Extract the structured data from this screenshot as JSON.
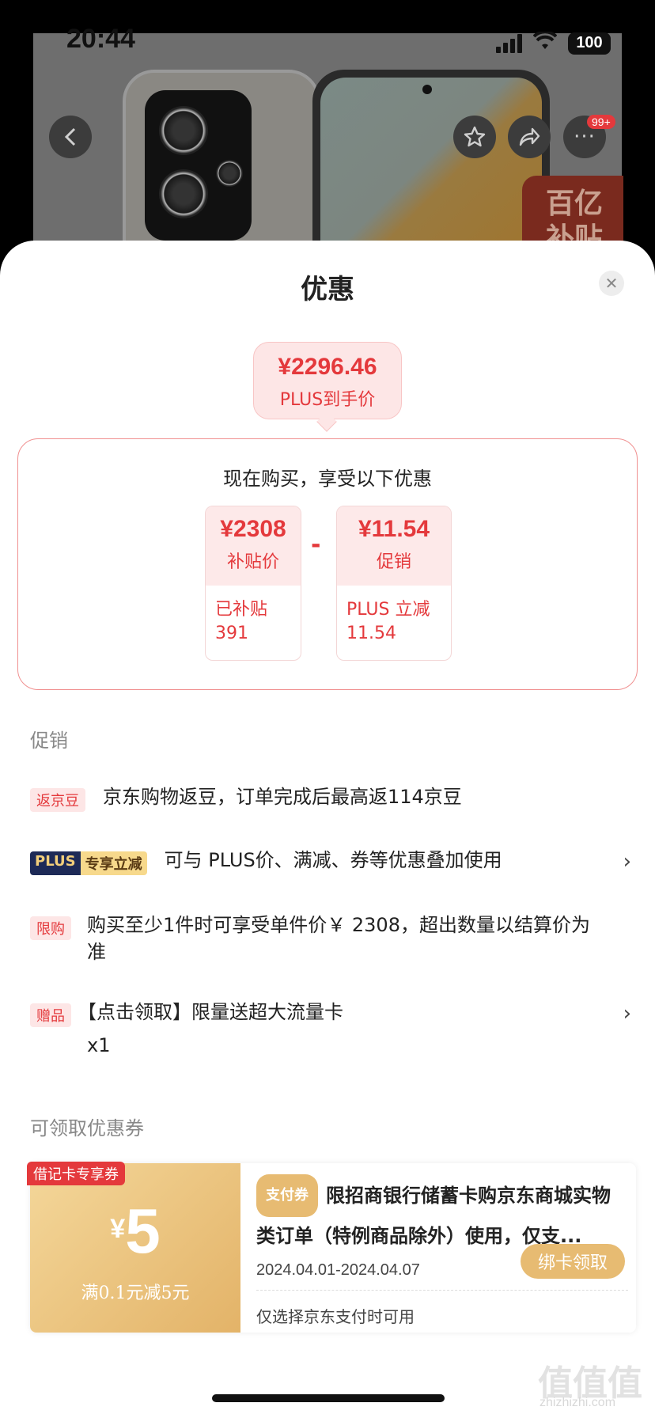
{
  "status_bar": {
    "time": "20:44",
    "battery": "100"
  },
  "top": {
    "subsidy_tag": "百亿\n补贴",
    "badge": "99+"
  },
  "sheet": {
    "title": "优惠",
    "final_price": {
      "amount": "¥2296.46",
      "label": "PLUS到手价"
    },
    "breakdown": {
      "title": "现在购买，享受以下优惠",
      "cards": [
        {
          "value": "¥2308",
          "label": "补贴价",
          "detail_line1": "已补贴",
          "detail_line2": "391"
        },
        {
          "value": "¥11.54",
          "label": "促销",
          "detail_line1": "PLUS 立减",
          "detail_line2": "11.54"
        }
      ],
      "operator": "-"
    },
    "promo_section": {
      "label": "促销",
      "items": [
        {
          "tag": "返京豆",
          "text": "京东购物返豆，订单完成后最高返114京豆"
        },
        {
          "tag_a": "PLUS",
          "tag_b": "专享立减",
          "text": "可与 PLUS价、满减、券等优惠叠加使用",
          "chevron": "›"
        },
        {
          "tag": "限购",
          "text": "购买至少1件时可享受单件价￥ 2308，超出数量以结算价为准"
        },
        {
          "tag": "赠品",
          "text": "【点击领取】限量送超大流量卡",
          "subtext": "x1",
          "chevron": "›"
        }
      ]
    },
    "coupon_section": {
      "label": "可领取优惠券",
      "coupon": {
        "flag": "借记卡专享券",
        "currency": "¥",
        "value": "5",
        "condition": "满0.1元减5元",
        "pay_tag": "支付券",
        "title": "限招商银行储蓄卡购京东商城实物类订单（特例商品除外）使用，仅支...",
        "date": "2024.04.01-2024.04.07",
        "button": "绑卡领取",
        "note": "仅选择京东支付时可用"
      }
    }
  },
  "watermark": {
    "main": "值值值",
    "sub": "zhizhizhi.com"
  }
}
